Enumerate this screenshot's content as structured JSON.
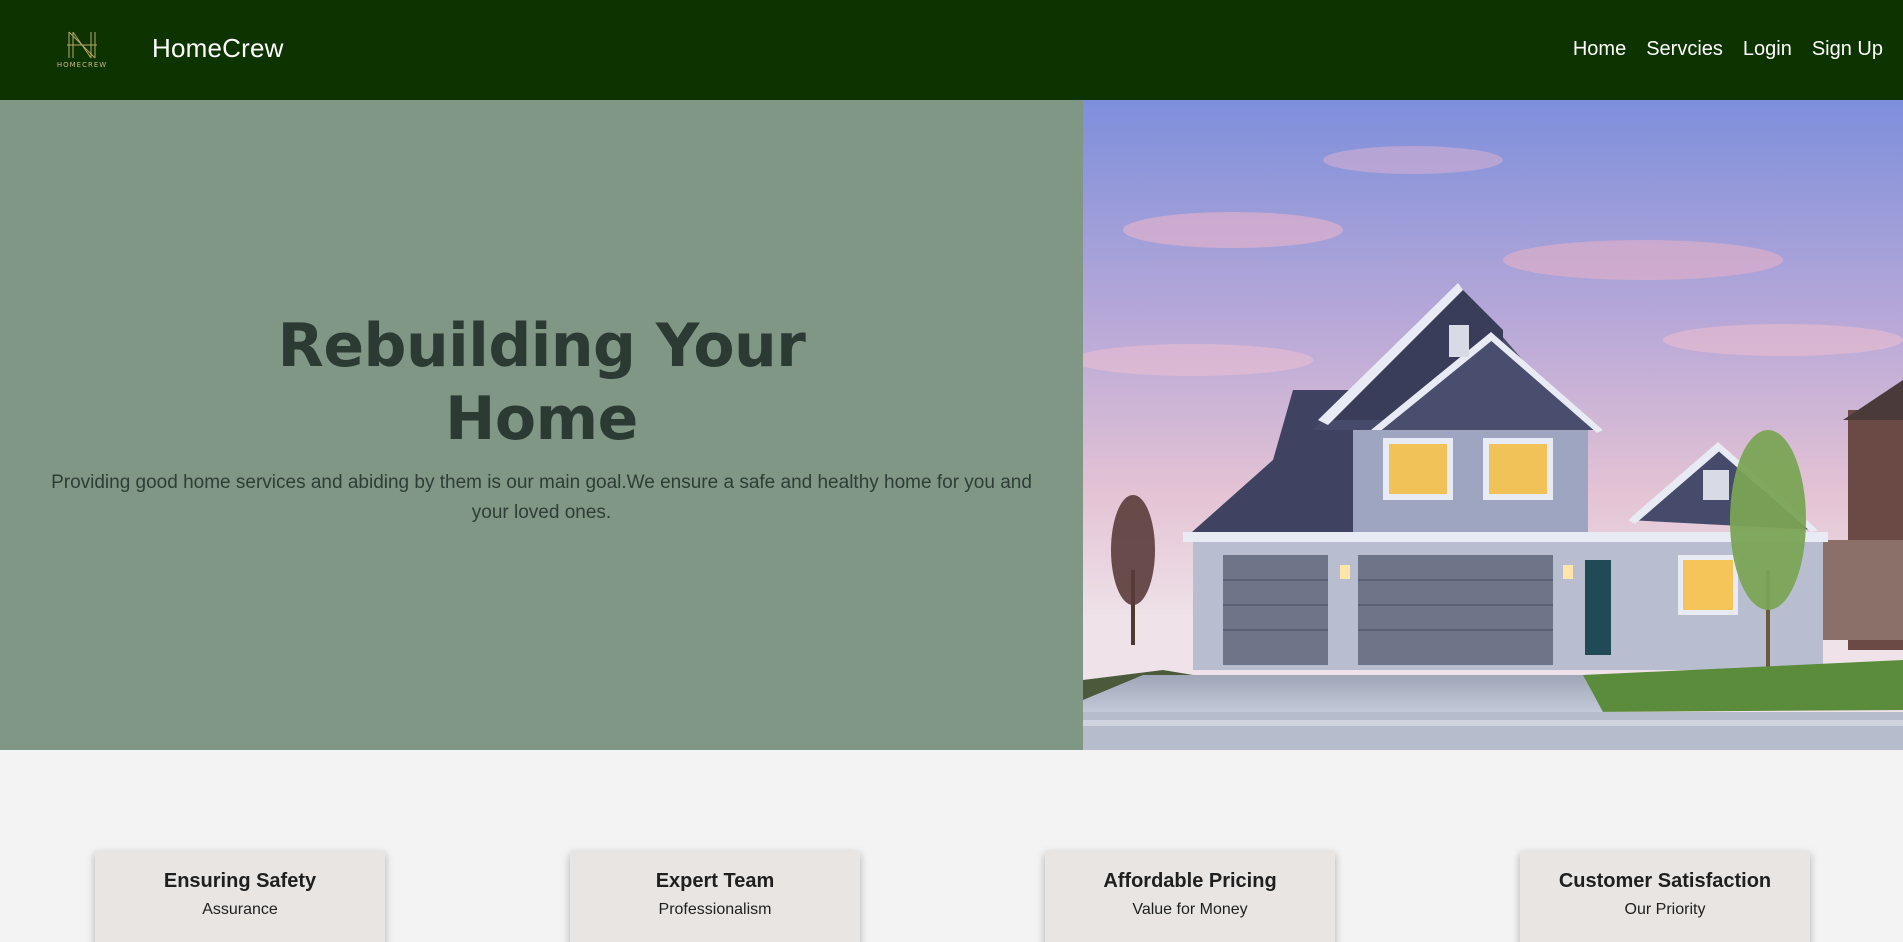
{
  "header": {
    "logo_text": "HOMECREW",
    "brand": "HomeCrew",
    "nav": [
      {
        "label": "Home"
      },
      {
        "label": "Servcies"
      },
      {
        "label": "Login"
      },
      {
        "label": "Sign Up"
      }
    ]
  },
  "hero": {
    "title_line1": "Rebuilding Your",
    "title_line2": "Home",
    "subtitle": "Providing good home services and abiding by them is our main goal.We ensure a safe and healthy home for you and your loved ones."
  },
  "features": [
    {
      "title": "Ensuring Safety",
      "subtitle": "Assurance"
    },
    {
      "title": "Expert Team",
      "subtitle": "Professionalism"
    },
    {
      "title": "Affordable Pricing",
      "subtitle": "Value for Money"
    },
    {
      "title": "Customer Satisfaction",
      "subtitle": "Our Priority"
    }
  ],
  "colors": {
    "navbar_bg": "#0c3300",
    "hero_bg": "#819785",
    "hero_text": "#2b3a33",
    "card_bg": "#e8e5e3"
  }
}
